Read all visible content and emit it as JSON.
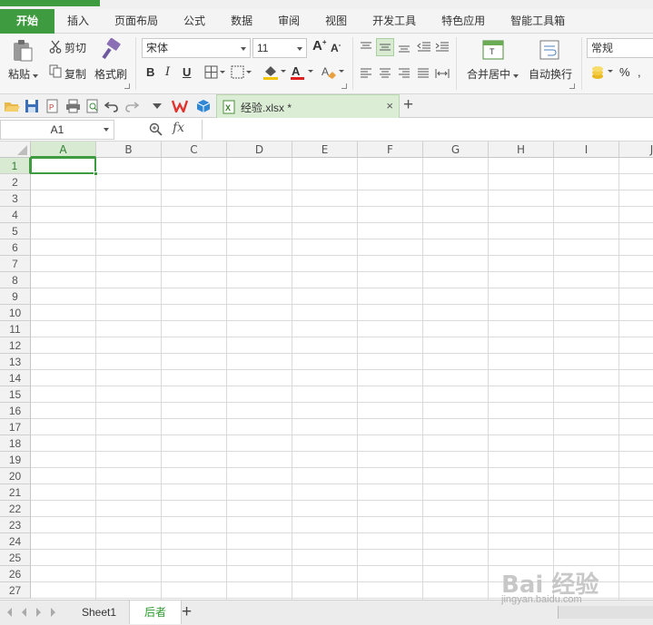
{
  "ribbon_tabs": [
    "开始",
    "插入",
    "页面布局",
    "公式",
    "数据",
    "审阅",
    "视图",
    "开发工具",
    "特色应用",
    "智能工具箱"
  ],
  "active_tab": "开始",
  "clipboard": {
    "paste": "粘贴",
    "cut": "剪切",
    "copy": "复制",
    "format_painter": "格式刷"
  },
  "font": {
    "name": "宋体",
    "size": "11",
    "bold": "B",
    "italic": "I",
    "underline": "U"
  },
  "alignment": {
    "merge_center": "合并居中",
    "wrap_text": "自动换行"
  },
  "number": {
    "format": "常规",
    "percent": "%"
  },
  "document_tab": {
    "name": "经验.xlsx *",
    "close": "×",
    "new_tab": "+"
  },
  "formula_bar": {
    "cell_ref": "A1",
    "fx": "fx",
    "value": ""
  },
  "columns": [
    "A",
    "B",
    "C",
    "D",
    "E",
    "F",
    "G",
    "H",
    "I",
    "J"
  ],
  "rows": [
    "1",
    "2",
    "3",
    "4",
    "5",
    "6",
    "7",
    "8",
    "9",
    "10",
    "11",
    "12",
    "13",
    "14",
    "15",
    "16",
    "17",
    "18",
    "19",
    "20",
    "21",
    "22",
    "23",
    "24",
    "25",
    "26",
    "27"
  ],
  "selected_cell": "A1",
  "sheets": [
    {
      "name": "Sheet1",
      "active": false
    },
    {
      "name": "后者",
      "active": true
    }
  ],
  "add_sheet": "+",
  "watermark": {
    "logo": "Bai 经验",
    "url": "jingyan.baidu.com"
  },
  "colors": {
    "accent": "#3f9b3f",
    "active_tab_text": "#ffffff",
    "sheet_active": "#2e9b2e"
  }
}
